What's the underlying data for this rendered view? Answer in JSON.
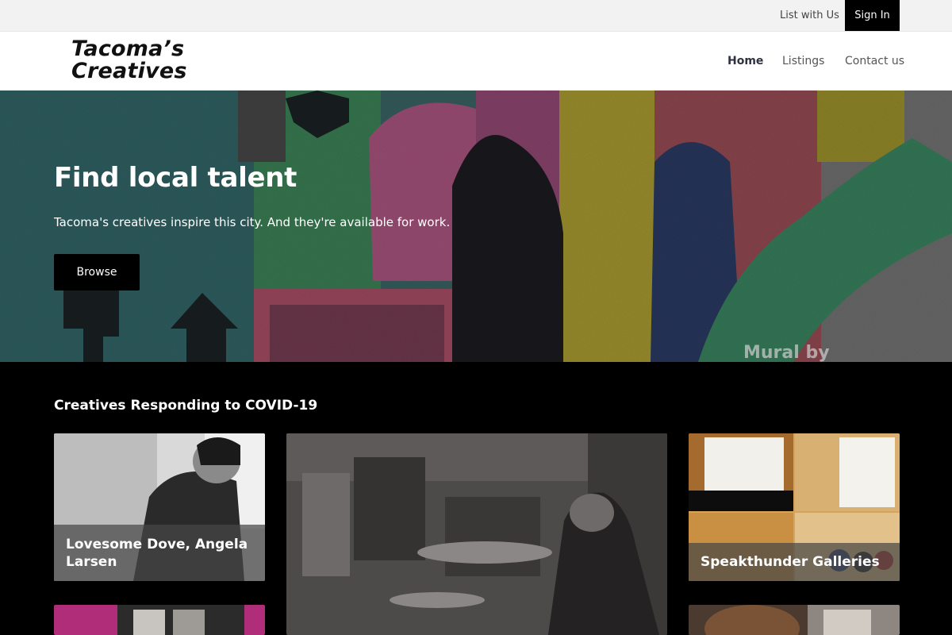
{
  "utility": {
    "list_with_us": "List with Us",
    "sign_in": "Sign In"
  },
  "header": {
    "logo_line1": "Tacoma’s",
    "logo_line2": "Creatives",
    "nav": {
      "home": "Home",
      "listings": "Listings",
      "contact": "Contact us"
    }
  },
  "hero": {
    "title": "Find local talent",
    "subtitle": "Tacoma's creatives inspire this city. And they're available for work.",
    "browse": "Browse",
    "mural_credit": "Mural by"
  },
  "section": {
    "title": "Creatives Responding to COVID-19",
    "cards": [
      {
        "caption_line1": "Lovesome Dove, Angela",
        "caption_line2": "Larsen"
      },
      {
        "caption": ""
      },
      {
        "caption": "Speakthunder Galleries"
      }
    ]
  }
}
